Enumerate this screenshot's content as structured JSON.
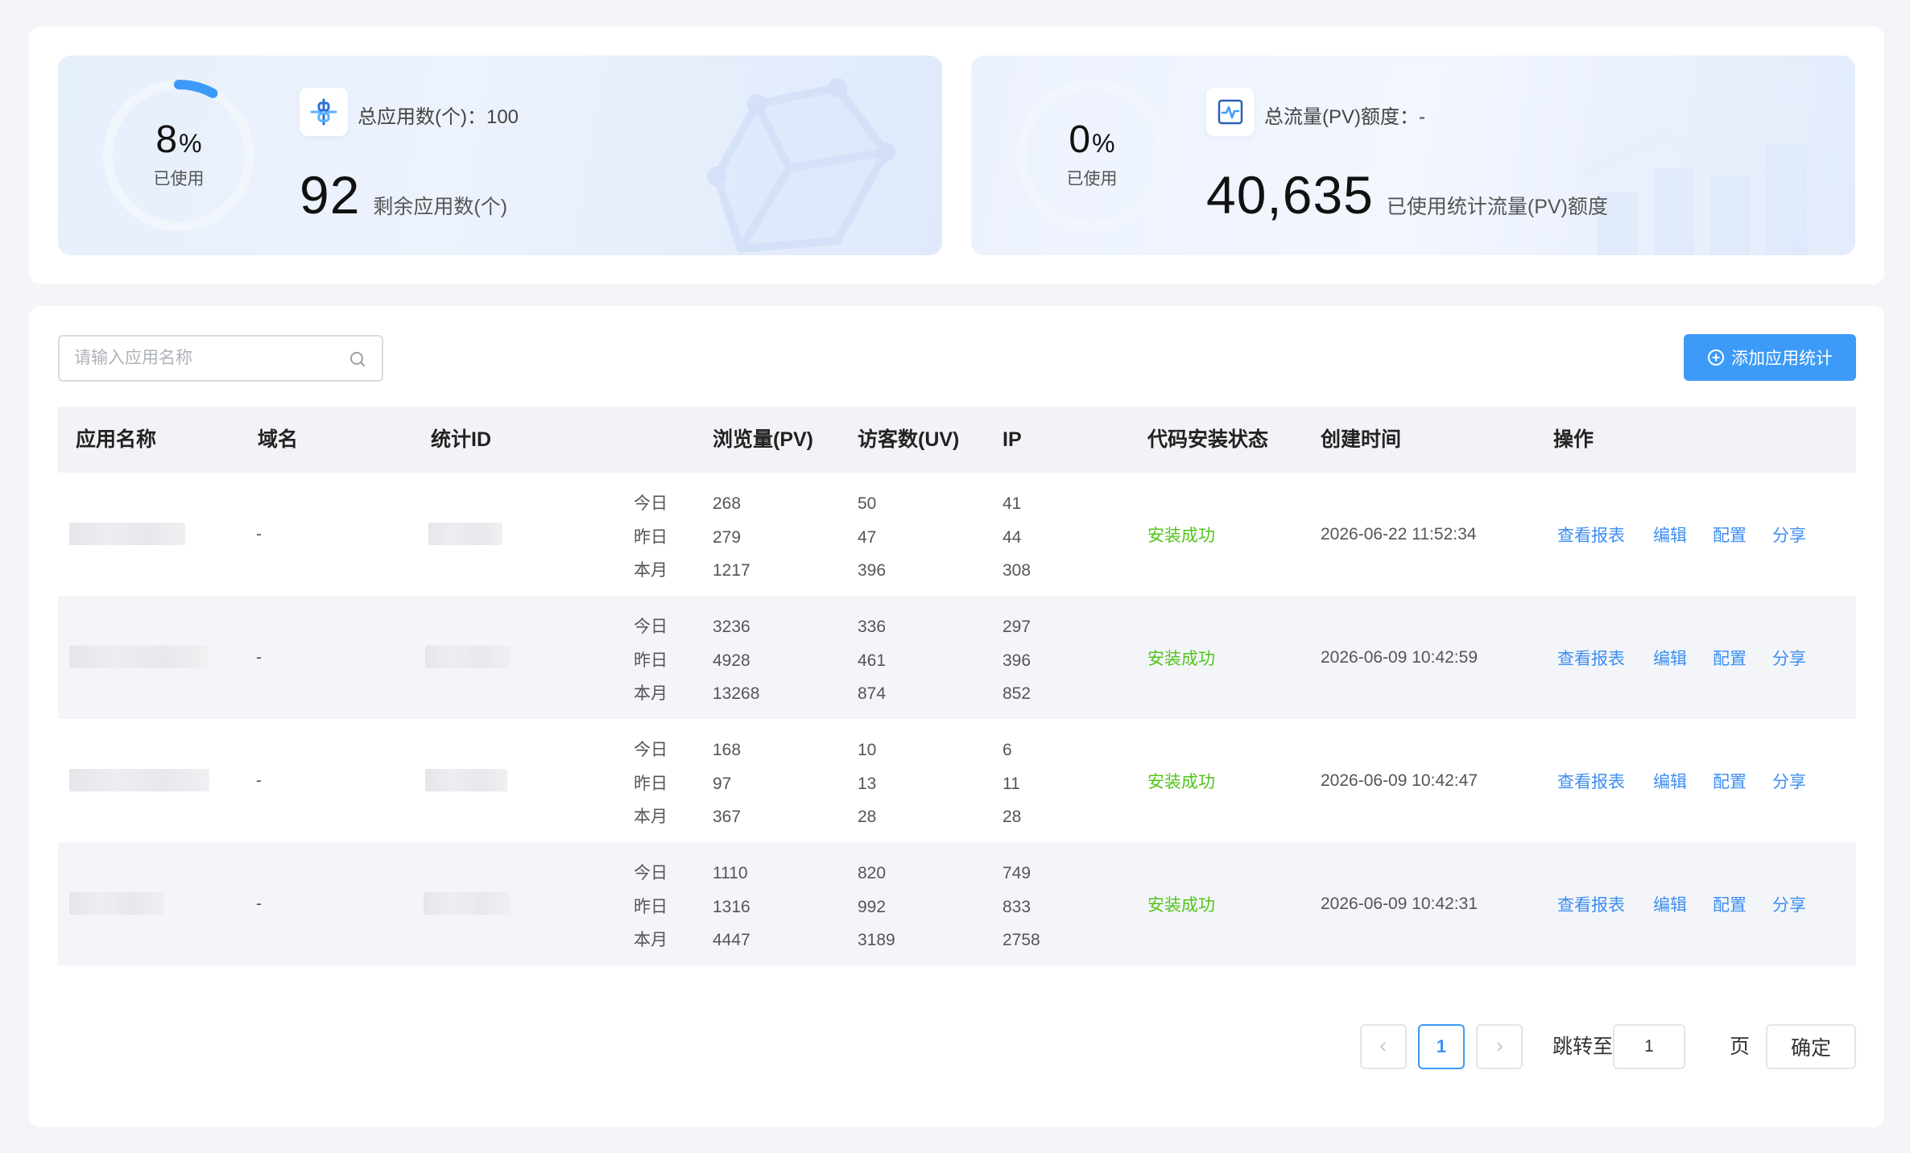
{
  "summary": {
    "apps": {
      "percent": "8",
      "percent_sign": "%",
      "used_label": "已使用",
      "ring_fraction": 0.08,
      "total_label": "总应用数(个)：100",
      "remaining_value": "92",
      "remaining_label": "剩余应用数(个)",
      "icon": "link-nodes-icon"
    },
    "traffic": {
      "percent": "0",
      "percent_sign": "%",
      "used_label": "已使用",
      "ring_fraction": 0,
      "total_label": "总流量(PV)额度：-",
      "used_value": "40,635",
      "used_value_label": "已使用统计流量(PV)额度",
      "icon": "pulse-chart-icon"
    }
  },
  "toolbar": {
    "search_placeholder": "请输入应用名称",
    "add_label": "添加应用统计"
  },
  "table": {
    "columns": [
      "应用名称",
      "域名",
      "统计ID",
      "浏览量(PV)",
      "访客数(UV)",
      "IP",
      "代码安装状态",
      "创建时间",
      "操作"
    ],
    "period_labels": [
      "今日",
      "昨日",
      "本月"
    ],
    "actions": [
      "查看报表",
      "编辑",
      "配置",
      "分享"
    ],
    "rows": [
      {
        "domain": "-",
        "pv": [
          "268",
          "279",
          "1217"
        ],
        "uv": [
          "50",
          "47",
          "396"
        ],
        "ip": [
          "41",
          "44",
          "308"
        ],
        "status": "安装成功",
        "created": "2026-06-22 11:52:34"
      },
      {
        "domain": "-",
        "pv": [
          "3236",
          "4928",
          "13268"
        ],
        "uv": [
          "336",
          "461",
          "874"
        ],
        "ip": [
          "297",
          "396",
          "852"
        ],
        "status": "安装成功",
        "created": "2026-06-09 10:42:59"
      },
      {
        "domain": "-",
        "pv": [
          "168",
          "97",
          "367"
        ],
        "uv": [
          "10",
          "13",
          "28"
        ],
        "ip": [
          "6",
          "11",
          "28"
        ],
        "status": "安装成功",
        "created": "2026-06-09 10:42:47"
      },
      {
        "domain": "-",
        "pv": [
          "1110",
          "1316",
          "4447"
        ],
        "uv": [
          "820",
          "992",
          "3189"
        ],
        "ip": [
          "749",
          "833",
          "2758"
        ],
        "status": "安装成功",
        "created": "2026-06-09 10:42:31"
      }
    ]
  },
  "pagination": {
    "current_page": "1",
    "jump_label": "跳转至第",
    "jump_value": "1",
    "page_suffix": "页",
    "confirm_label": "确定"
  },
  "colors": {
    "accent": "#3d9bf7",
    "success": "#52c41a",
    "link": "#3d8ef0"
  }
}
